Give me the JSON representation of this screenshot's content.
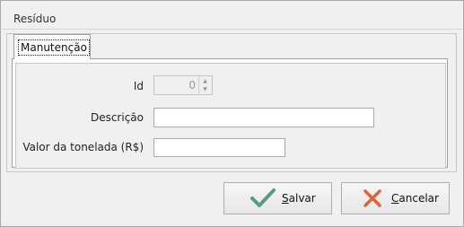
{
  "window": {
    "title": "Resíduo"
  },
  "tabs": [
    {
      "label": "Manutenção",
      "selected": true
    }
  ],
  "form": {
    "id": {
      "label": "Id",
      "value": "0"
    },
    "descricao": {
      "label": "Descrição",
      "value": ""
    },
    "valor": {
      "label": "Valor da tonelada (R$)",
      "value": ""
    }
  },
  "buttons": {
    "save": {
      "mnemonic": "S",
      "rest": "alvar",
      "icon": "check-icon",
      "icon_color": "#5a9a8a"
    },
    "cancel": {
      "mnemonic": "C",
      "rest": "ancelar",
      "icon": "x-icon",
      "icon_color": "#e0623a"
    }
  }
}
